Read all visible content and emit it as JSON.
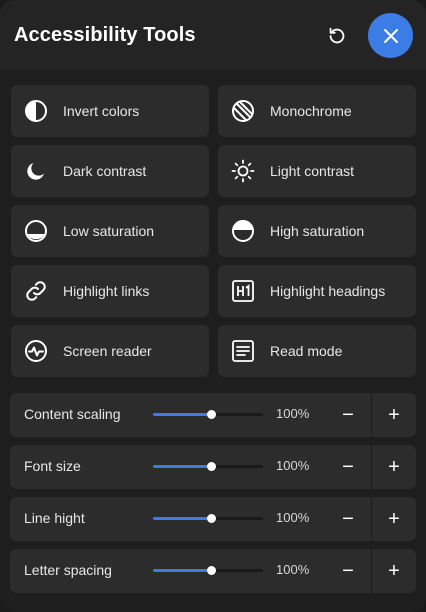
{
  "header": {
    "title": "Accessibility Tools",
    "reset_icon": "reset-icon",
    "close_icon": "close-icon",
    "accent": "#3b7ce5"
  },
  "tools": [
    {
      "label": "Invert colors",
      "icon": "invert-colors-icon"
    },
    {
      "label": "Monochrome",
      "icon": "monochrome-icon"
    },
    {
      "label": "Dark contrast",
      "icon": "moon-icon"
    },
    {
      "label": "Light contrast",
      "icon": "sun-icon"
    },
    {
      "label": "Low saturation",
      "icon": "low-saturation-icon"
    },
    {
      "label": "High saturation",
      "icon": "high-saturation-icon"
    },
    {
      "label": "Highlight links",
      "icon": "link-icon"
    },
    {
      "label": "Highlight headings",
      "icon": "heading-icon"
    },
    {
      "label": "Screen reader",
      "icon": "screen-reader-icon"
    },
    {
      "label": "Read mode",
      "icon": "read-mode-icon"
    }
  ],
  "adjusters": [
    {
      "label": "Content scaling",
      "value": "100%",
      "level": 0.53,
      "minus": "−",
      "plus": "+"
    },
    {
      "label": "Font size",
      "value": "100%",
      "level": 0.53,
      "minus": "−",
      "plus": "+"
    },
    {
      "label": "Line hight",
      "value": "100%",
      "level": 0.53,
      "minus": "−",
      "plus": "+"
    },
    {
      "label": "Letter spacing",
      "value": "100%",
      "level": 0.53,
      "minus": "−",
      "plus": "+"
    }
  ]
}
